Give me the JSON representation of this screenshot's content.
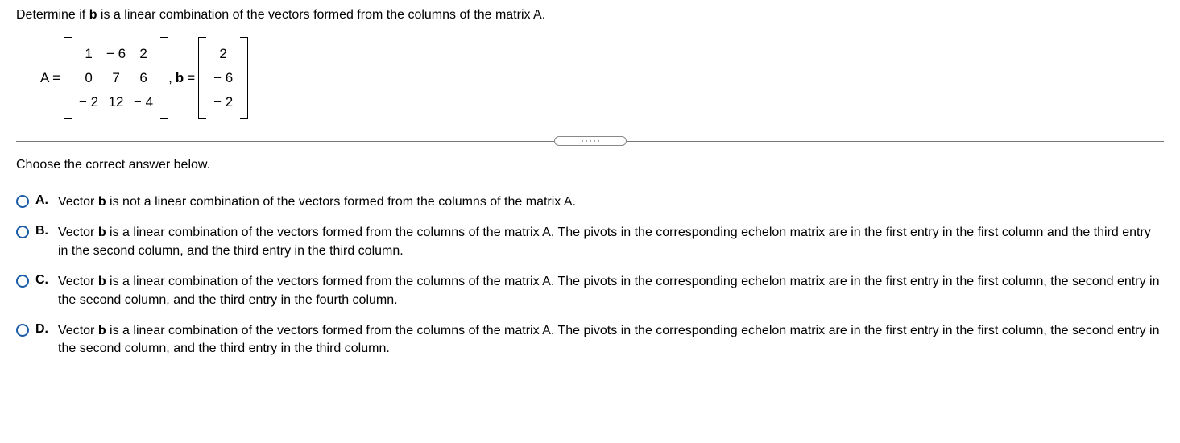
{
  "question": {
    "line1_pre": "Determine if ",
    "b": "b",
    "line1_post": " is a linear combination of the vectors formed from the columns of the matrix A."
  },
  "equation": {
    "A_label": "A =",
    "A_rows": [
      [
        "1",
        "− 6",
        "2"
      ],
      [
        "0",
        "7",
        "6"
      ],
      [
        "− 2",
        "12",
        "− 4"
      ]
    ],
    "comma": ", ",
    "b_pre": "b",
    "b_label": " =",
    "b_rows": [
      [
        "2"
      ],
      [
        "− 6"
      ],
      [
        "− 2"
      ]
    ]
  },
  "prompt": "Choose the correct answer below.",
  "options": [
    {
      "letter": "A.",
      "pre": "Vector ",
      "b": "b",
      "post": " is not a linear combination of the vectors formed from the columns of the matrix A."
    },
    {
      "letter": "B.",
      "pre": "Vector ",
      "b": "b",
      "post": " is a linear combination of the vectors formed from the columns of the matrix A. The pivots in the corresponding echelon matrix are in the first entry in the first column and the third entry in the second column, and the third entry in the third column."
    },
    {
      "letter": "C.",
      "pre": "Vector ",
      "b": "b",
      "post": " is a linear combination of the vectors formed from the columns of the matrix A. The pivots in the corresponding echelon matrix are in the first entry in the first column, the second entry in the second column, and the third entry in the fourth column."
    },
    {
      "letter": "D.",
      "pre": "Vector ",
      "b": "b",
      "post": " is a linear combination of the vectors formed from the columns of the matrix A. The pivots in the corresponding echelon matrix are in the first entry in the first column, the second entry in the second column, and the third entry in the third column."
    }
  ]
}
